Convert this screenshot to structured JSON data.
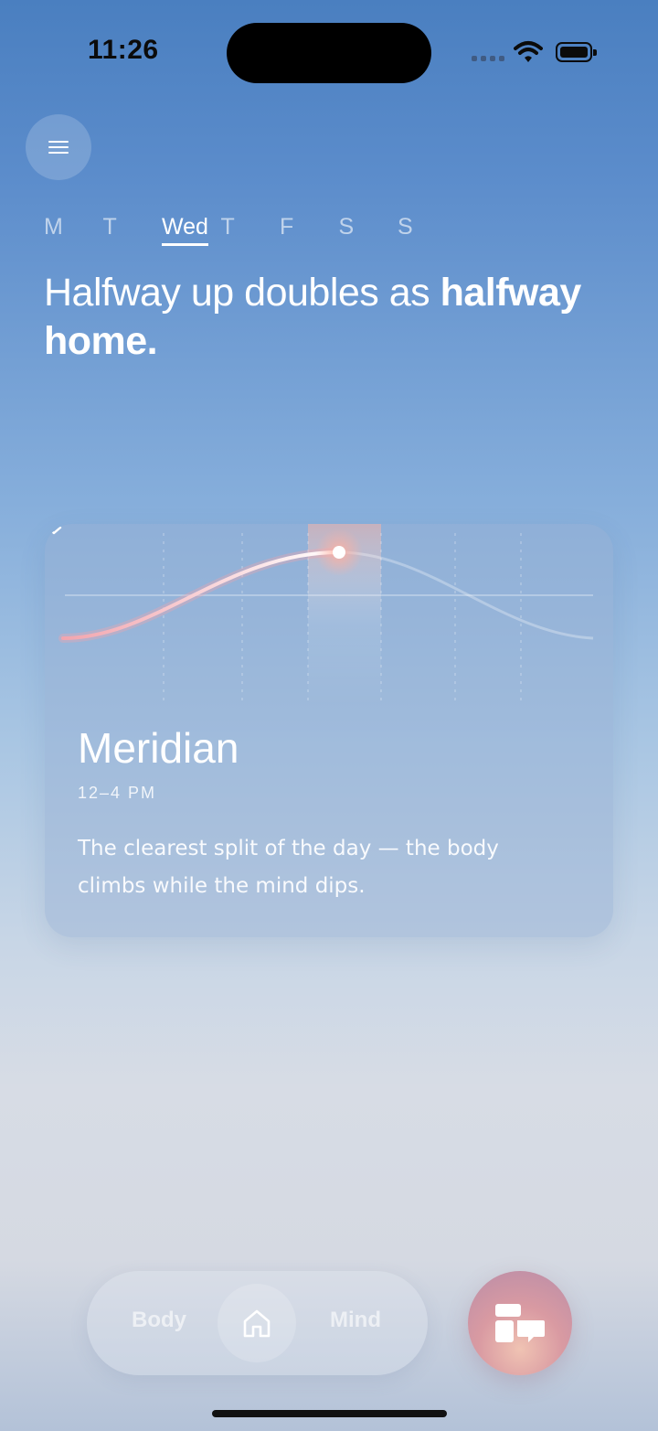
{
  "status_bar": {
    "time": "11:26"
  },
  "week": {
    "days": [
      "M",
      "T",
      "Wed",
      "T",
      "F",
      "S",
      "S"
    ],
    "selected_index": 2
  },
  "headline": {
    "text": "Halfway up doubles as ",
    "bold": "halfway home."
  },
  "card": {
    "title": "Meridian",
    "time_range": "12–4 PM",
    "description": "The clearest split of the day — the body climbs while the mind dips."
  },
  "tab_bar": {
    "body_label": "Body",
    "mind_label": "Mind"
  },
  "icons": [
    "menu-icon",
    "home-icon",
    "chat-icon",
    "chevron-down-icon",
    "wifi-icon",
    "battery-icon"
  ],
  "colors": {
    "accent_glow": "#f5a9a0"
  }
}
